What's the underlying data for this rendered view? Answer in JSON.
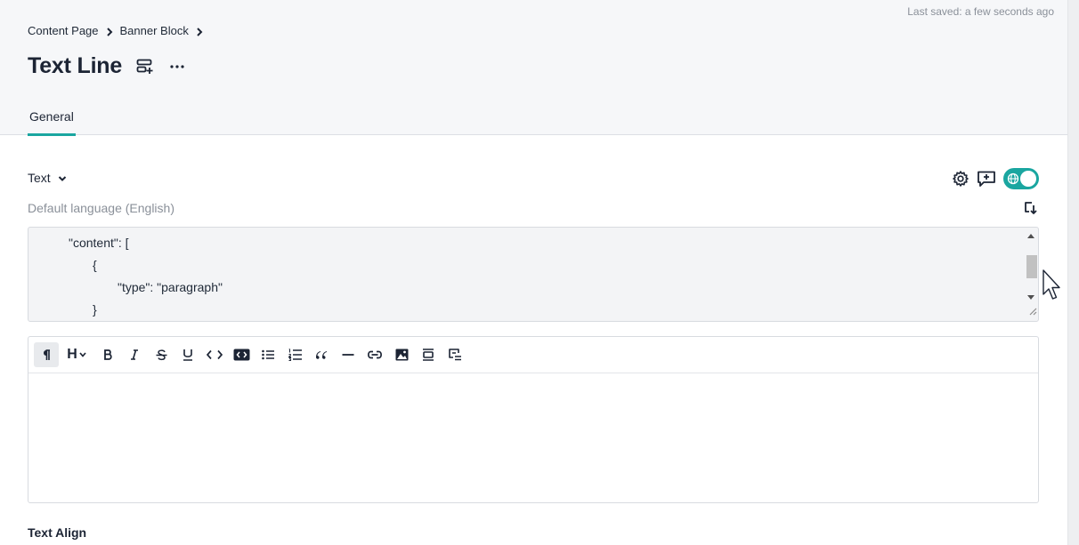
{
  "header": {
    "last_saved": "Last saved: a few seconds ago",
    "breadcrumb": [
      {
        "label": "Content Page"
      },
      {
        "label": "Banner Block"
      }
    ],
    "title": "Text Line",
    "icons": {
      "save_template": "layout-add-icon",
      "more": "more-horizontal-icon"
    },
    "tabs": [
      {
        "label": "General",
        "active": true
      }
    ]
  },
  "field": {
    "label": "Text",
    "language_label": "Default language (English)",
    "tools": [
      "settings-icon",
      "add-comment-icon",
      "localize-toggle"
    ],
    "localize_enabled": true,
    "json_lines": [
      "\"content\": [",
      "{",
      "\"type\": \"paragraph\"",
      "}"
    ]
  },
  "toolbar": {
    "heading_label": "H",
    "buttons": [
      "paragraph",
      "heading",
      "bold",
      "italic",
      "strikethrough",
      "underline",
      "code",
      "code-block",
      "bullet-list",
      "ordered-list",
      "blockquote",
      "horizontal-rule",
      "link",
      "image",
      "embed",
      "block"
    ]
  },
  "section": {
    "text_align_label": "Text Align"
  },
  "colors": {
    "accent": "#1aa6a0",
    "text": "#1c2434",
    "muted": "#8a9099"
  }
}
